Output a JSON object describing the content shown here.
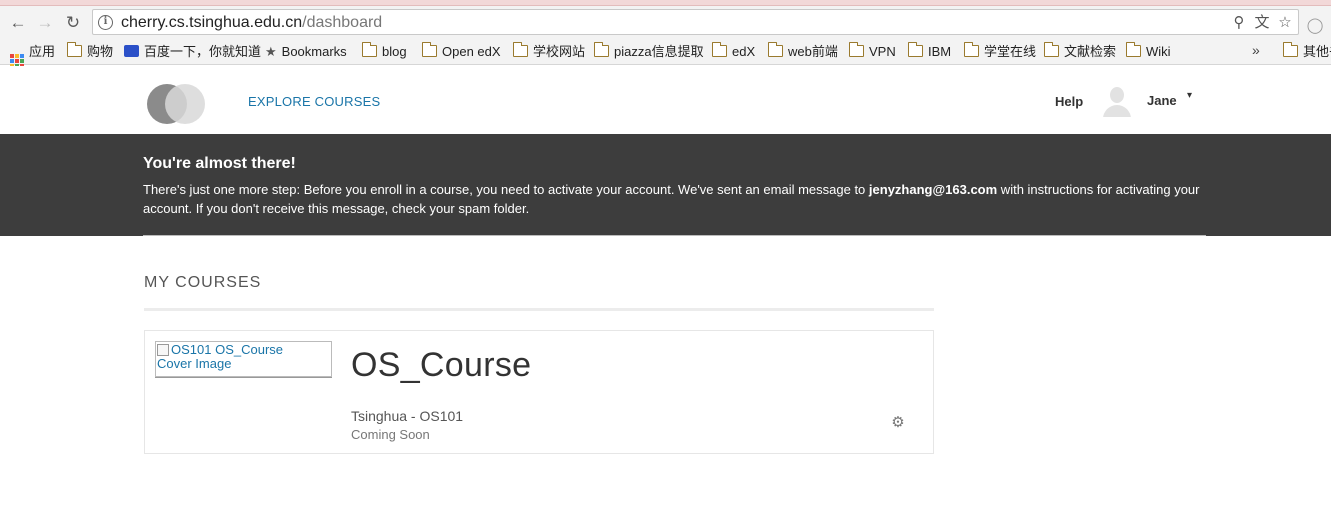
{
  "browser": {
    "url_host": "cherry.cs.tsinghua.edu.cn",
    "url_path": "/dashboard",
    "bookmarks": [
      {
        "label": "应用",
        "icon": "apps-grid-icon"
      },
      {
        "label": "购物",
        "icon": "folder-icon"
      },
      {
        "label": "百度一下，你就知道",
        "icon": "baidu-paw-icon"
      },
      {
        "label": "Bookmarks",
        "icon": "star-icon"
      },
      {
        "label": "blog",
        "icon": "folder-icon"
      },
      {
        "label": "Open edX",
        "icon": "folder-icon"
      },
      {
        "label": "学校网站",
        "icon": "folder-icon"
      },
      {
        "label": "piazza信息提取",
        "icon": "folder-icon"
      },
      {
        "label": "edX",
        "icon": "folder-icon"
      },
      {
        "label": "web前端",
        "icon": "folder-icon"
      },
      {
        "label": "VPN",
        "icon": "folder-icon"
      },
      {
        "label": "IBM",
        "icon": "folder-icon"
      },
      {
        "label": "学堂在线",
        "icon": "folder-icon"
      },
      {
        "label": "文献检索",
        "icon": "folder-icon"
      },
      {
        "label": "Wiki",
        "icon": "folder-icon"
      }
    ],
    "overflow_chevron": "»",
    "other_bookmarks": "其他书签"
  },
  "header": {
    "explore_label": "EXPLORE COURSES",
    "help_label": "Help",
    "username": "Jane",
    "caret": "▾"
  },
  "notice": {
    "title": "You're almost there!",
    "text_before": "There's just one more step: Before you enroll in a course, you need to activate your account. We've sent an email message to ",
    "email": "jenyzhang@163.com",
    "text_after": " with instructions for activating your account. If you don't receive this message, check your spam folder."
  },
  "my_courses": {
    "title": "MY COURSES",
    "courses": [
      {
        "cover_alt": "OS101 OS_Course Cover Image",
        "title": "OS_Course",
        "org": "Tsinghua - OS101",
        "status": "Coming Soon"
      }
    ]
  },
  "colors": {
    "link_blue": "#1a75a8",
    "banner_bg": "#3d3d3d",
    "tabstrip": "#f2d8d8"
  }
}
